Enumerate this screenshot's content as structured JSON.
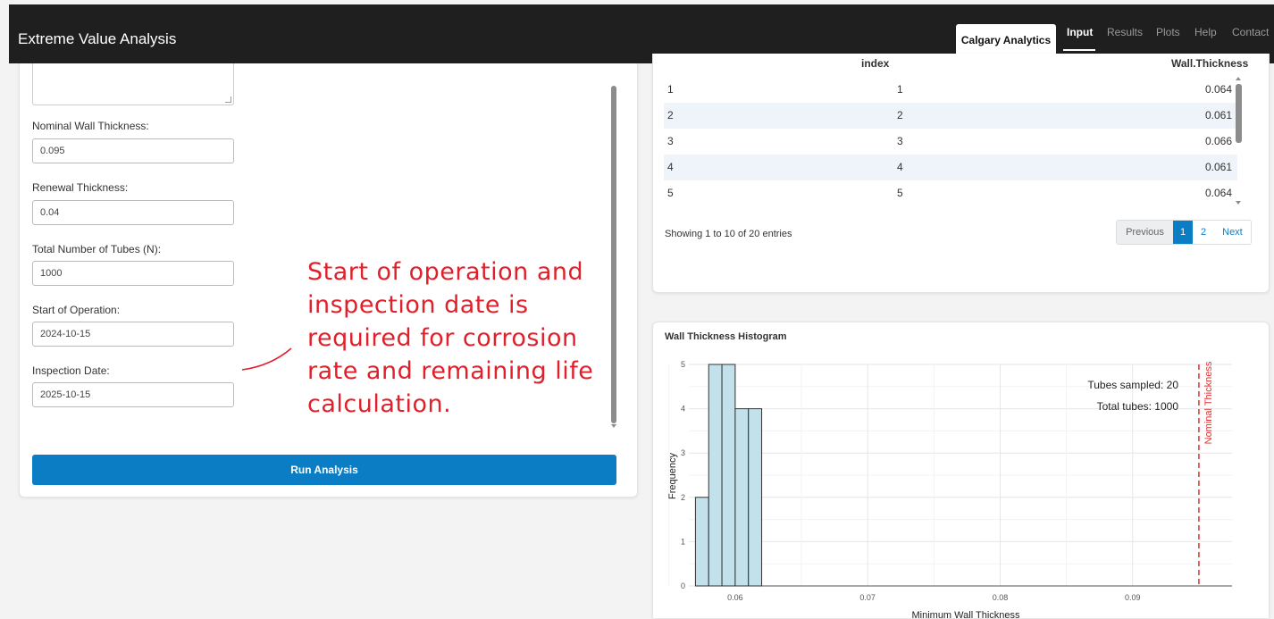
{
  "navbar": {
    "title": "Extreme Value Analysis",
    "company_button": "Calgary Analytics",
    "tabs": [
      "Input",
      "Results",
      "Plots",
      "Help",
      "Contact"
    ],
    "active_tab": "Input"
  },
  "form": {
    "fields": [
      {
        "label": "Nominal Wall Thickness:",
        "value": "0.095"
      },
      {
        "label": "Renewal Thickness:",
        "value": "0.04"
      },
      {
        "label": "Total Number of Tubes (N):",
        "value": "1000"
      },
      {
        "label": "Start of Operation:",
        "value": "2024-10-15"
      },
      {
        "label": "Inspection Date:",
        "value": "2025-10-15"
      }
    ],
    "run_button": "Run Analysis"
  },
  "table": {
    "headers": [
      "",
      "index",
      "Wall.Thickness"
    ],
    "rows": [
      [
        "1",
        "1",
        "0.064"
      ],
      [
        "2",
        "2",
        "0.061"
      ],
      [
        "3",
        "3",
        "0.066"
      ],
      [
        "4",
        "4",
        "0.061"
      ],
      [
        "5",
        "5",
        "0.064"
      ]
    ],
    "info": "Showing 1 to 10 of 20 entries",
    "pagination": {
      "previous": "Previous",
      "pages": [
        "1",
        "2"
      ],
      "active_page": "1",
      "next": "Next"
    }
  },
  "histogram_panel": {
    "title": "Wall Thickness Histogram"
  },
  "annotation": {
    "lines": [
      "Start of operation and",
      "inspection date is",
      "required for corrosion",
      "rate and remaining life",
      "calculation."
    ],
    "color": "#e0202a"
  },
  "colors": {
    "navbar": "#1f1f1f",
    "primary": "#0b7dc5",
    "bar_fill": "#c3e1eb",
    "nominal_line": "#e03030"
  },
  "chart_data": {
    "type": "bar",
    "xlabel": "Minimum Wall Thickness",
    "ylabel": "Frequency",
    "xlim": [
      0.0565,
      0.0975
    ],
    "ylim": [
      0,
      5
    ],
    "x_ticks": [
      "0.06",
      "0.07",
      "0.08",
      "0.09"
    ],
    "x_tick_values": [
      0.06,
      0.07,
      0.08,
      0.09
    ],
    "y_ticks": [
      "0",
      "1",
      "2",
      "3",
      "4",
      "5"
    ],
    "bin_width": 0.001,
    "bins": [
      {
        "start": 0.057,
        "count": 2
      },
      {
        "start": 0.058,
        "count": 5
      },
      {
        "start": 0.059,
        "count": 5
      },
      {
        "start": 0.06,
        "count": 4
      },
      {
        "start": 0.061,
        "count": 4
      }
    ],
    "reference_line": {
      "x": 0.095,
      "label": "Nominal Thickness"
    },
    "annotations": [
      "Tubes sampled: 20",
      "Total tubes: 1000"
    ],
    "grid": true
  }
}
